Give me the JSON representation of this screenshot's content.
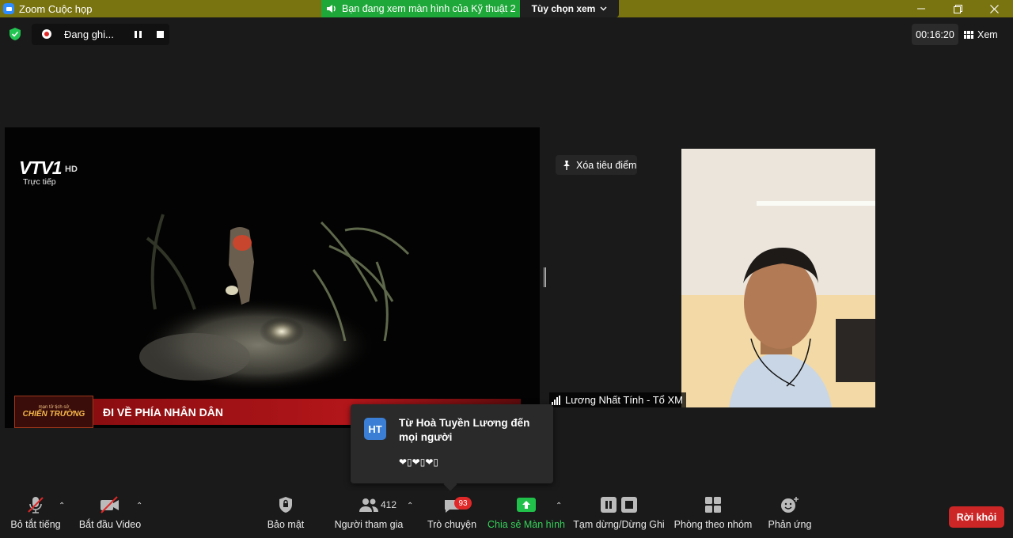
{
  "titlebar": {
    "app_title": "Zoom Cuộc họp",
    "share_banner": "Bạn đang xem màn hình của Kỹ thuật 2",
    "view_options": "Tùy chọn xem"
  },
  "recording": {
    "label": "Đang ghi..."
  },
  "timer": "00:16:20",
  "view_button": "Xem",
  "shared_video": {
    "channel_logo": "VTV1",
    "hd": "HD",
    "live_text": "Trực tiếp",
    "badge_small": "mạn tử tịch sử",
    "badge_big": "CHIẾN TRƯỜNG",
    "headline": "ĐI VỀ PHÍA NHÂN DÂN"
  },
  "spotlight": {
    "remove_label": "Xóa tiêu điểm"
  },
  "participant": {
    "name": "Lương Nhất Tính - Tổ XM"
  },
  "chat_toast": {
    "avatar_initials": "HT",
    "from": "Từ Hoà Tuyền Lương đến mọi người",
    "message": "❤▯❤▯❤▯"
  },
  "toolbar": {
    "mute": "Bỏ tắt tiếng",
    "start_video": "Bắt đầu Video",
    "security": "Bảo mật",
    "participants": "Người tham gia",
    "participants_count": "412",
    "chat": "Trò chuyện",
    "chat_badge": "93",
    "share_screen": "Chia sẻ Màn hình",
    "pause_stop_recording": "Tạm dừng/Dừng Ghi",
    "breakout_rooms": "Phòng theo nhóm",
    "reactions": "Phản ứng",
    "leave": "Rời khỏi"
  },
  "colors": {
    "titlebar": "#7a7410",
    "share_banner": "#1fa83a",
    "leave": "#cc2626",
    "share_icon": "#21c04a",
    "badge": "#e02828"
  }
}
